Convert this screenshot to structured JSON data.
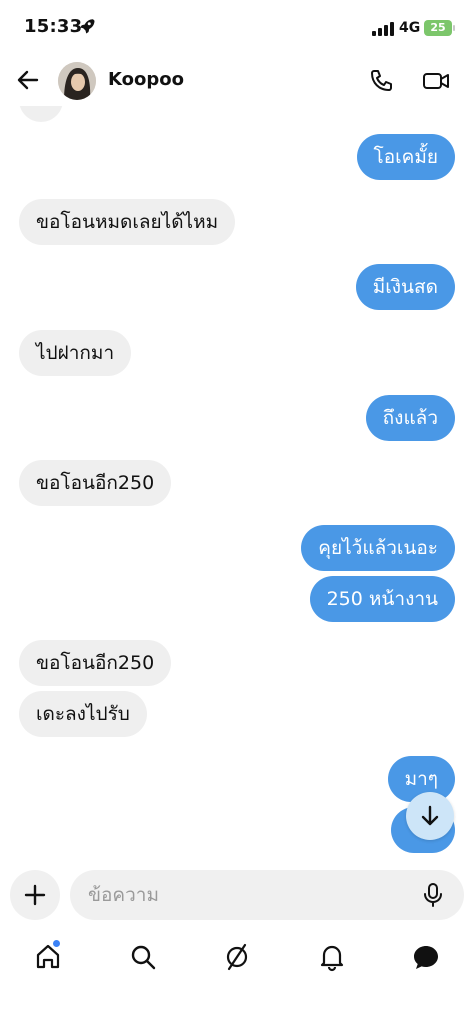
{
  "status_bar": {
    "time": "15:33",
    "network": "4G",
    "battery": "25"
  },
  "header": {
    "contact_name": "Koopoo"
  },
  "messages": [
    {
      "text": "โอเคมั้ย",
      "side": "out"
    },
    {
      "text": "ขอโอนหมดเลยได้ไหม",
      "side": "in"
    },
    {
      "text": "มีเงินสด",
      "side": "out"
    },
    {
      "text": "ไปฝากมา",
      "side": "in"
    },
    {
      "text": "ถึงแล้ว",
      "side": "out"
    },
    {
      "text": "ขอโอนอีก250",
      "side": "in"
    },
    {
      "text": "คุยไว้แล้วเนอะ",
      "side": "out"
    },
    {
      "text": "250 หน้างาน",
      "side": "out"
    },
    {
      "text": "ขอโอนอีก250",
      "side": "in"
    },
    {
      "text": "เดะลงไปรับ",
      "side": "in"
    },
    {
      "text": "มาๆ",
      "side": "out"
    }
  ],
  "composer": {
    "placeholder": "ข้อความ"
  },
  "icons": {
    "back": "arrow-left-icon",
    "call": "phone-icon",
    "video": "video-camera-icon",
    "plus": "plus-icon",
    "mic": "microphone-icon",
    "scroll_down": "arrow-down-icon",
    "tabs": [
      "home-icon",
      "search-icon",
      "explore-icon",
      "bell-icon",
      "chat-bubble-icon"
    ]
  },
  "colors": {
    "outgoing_bubble": "#4a98e6",
    "incoming_bubble": "#efefef",
    "notification_dot": "#3b82f6",
    "battery": "#7cc66b"
  }
}
